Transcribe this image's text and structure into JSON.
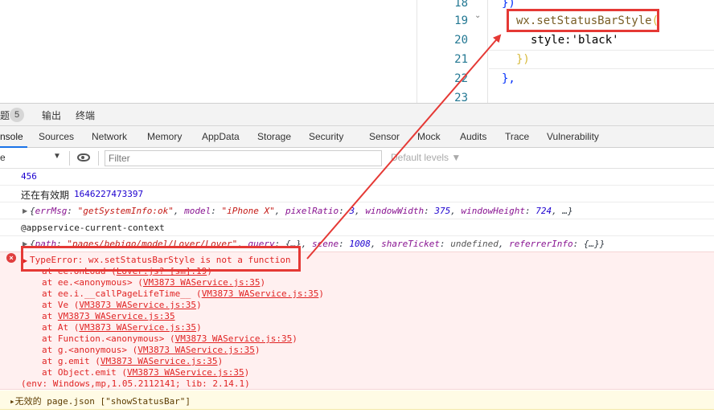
{
  "editor": {
    "lines": [
      {
        "num": "18",
        "text": "})"
      },
      {
        "num": "19",
        "call": "wx.setStatusBarStyle",
        "brace": "("
      },
      {
        "num": "20",
        "text": "style:'black'"
      },
      {
        "num": "21",
        "text": "})"
      },
      {
        "num": "22",
        "text": "},"
      },
      {
        "num": "23",
        "text": ""
      }
    ]
  },
  "devtools": {
    "top_tabs": {
      "problems_badge": "5",
      "output": "输出",
      "terminal": "终端",
      "problems_partial": "题"
    },
    "tabs": [
      "nsole",
      "Sources",
      "Network",
      "Memory",
      "AppData",
      "Storage",
      "Security",
      "Sensor",
      "Mock",
      "Audits",
      "Trace",
      "Vulnerability"
    ],
    "active_tab": "nsole",
    "toolbar": {
      "context_partial": "e",
      "filter_placeholder": "Filter",
      "levels": "Default levels ▼"
    }
  },
  "console": {
    "log1": "456",
    "log2_label": "还在有效期",
    "log2_value": "1646227473397",
    "obj1": {
      "open": "{",
      "errMsg_key": "errMsg",
      "errMsg_val": "\"getSystemInfo:ok\"",
      "model_key": "model",
      "model_val": "\"iPhone X\"",
      "pixel_key": "pixelRatio",
      "pixel_val": "3",
      "ww_key": "windowWidth",
      "ww_val": "375",
      "wh_key": "windowHeight",
      "wh_val": "724",
      "tail": ", …}"
    },
    "context_log": "@appservice-current-context",
    "obj2": {
      "path_key": "path",
      "path_val": "\"pages/bebigo/model/Lover/Lover\"",
      "query_key": "query",
      "query_val": "{…}",
      "scene_key": "scene",
      "scene_val": "1008",
      "share_key": "shareTicket",
      "share_val": "undefined",
      "ref_key": "referrerInfo",
      "ref_val": "{…}}"
    },
    "error_title": "TypeError: wx.setStatusBarStyle is not a function",
    "stack": [
      {
        "fn": "at ee.onLoad (",
        "src": "Lover.js? [sm]:19",
        "end": ")"
      },
      {
        "fn": "at ee.<anonymous> (",
        "src": "VM3873 WAService.js:35",
        "end": ")"
      },
      {
        "fn": "at ee.i.__callPageLifeTime__ (",
        "src": "VM3873 WAService.js:35",
        "end": ")"
      },
      {
        "fn": "at Ve (",
        "src": "VM3873 WAService.js:35",
        "end": ")"
      },
      {
        "fn": "at ",
        "src": "VM3873 WAService.js:35",
        "end": ""
      },
      {
        "fn": "at At (",
        "src": "VM3873 WAService.js:35",
        "end": ")"
      },
      {
        "fn": "at Function.<anonymous> (",
        "src": "VM3873 WAService.js:35",
        "end": ")"
      },
      {
        "fn": "at g.<anonymous> (",
        "src": "VM3873 WAService.js:35",
        "end": ")"
      },
      {
        "fn": "at g.emit (",
        "src": "VM3873 WAService.js:35",
        "end": ")"
      },
      {
        "fn": "at Object.emit (",
        "src": "VM3873 WAService.js:35",
        "end": ")"
      }
    ],
    "env": "(env: Windows,mp,1.05.2112141; lib: 2.14.1)",
    "warning": "▸无效的 page.json [\"showStatusBar\"]"
  },
  "colors": {
    "annotation": "#e53935",
    "error_bg": "#fff0f0",
    "error_text": "#e02424",
    "warn_bg": "#fffbe5"
  }
}
